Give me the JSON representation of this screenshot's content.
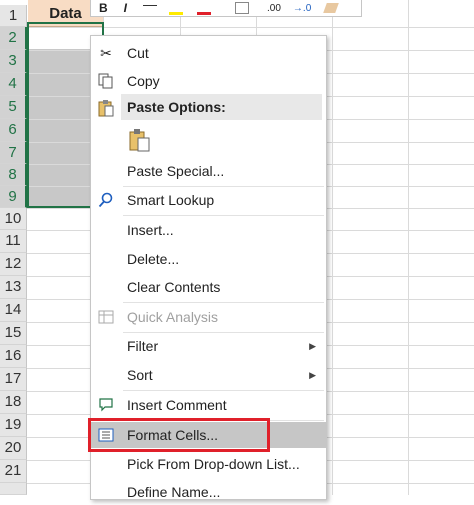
{
  "sheet": {
    "column_a_header": "Data",
    "row_numbers": [
      "1",
      "2",
      "3",
      "4",
      "5",
      "6",
      "7",
      "8",
      "9",
      "10",
      "11",
      "12",
      "13",
      "14",
      "15",
      "16",
      "17",
      "18",
      "19",
      "20",
      "21"
    ]
  },
  "mini_toolbar": {
    "bold": "B",
    "italic": "I",
    "decimal_increase": ".00",
    "decimal_decrease": "→.0"
  },
  "context_menu": {
    "cut": "Cut",
    "copy": "Copy",
    "paste_options": "Paste Options:",
    "paste_special": "Paste Special...",
    "smart_lookup": "Smart Lookup",
    "insert": "Insert...",
    "delete": "Delete...",
    "clear_contents": "Clear Contents",
    "quick_analysis": "Quick Analysis",
    "filter": "Filter",
    "sort": "Sort",
    "insert_comment": "Insert Comment",
    "format_cells": "Format Cells...",
    "pick_from_dropdown": "Pick From Drop-down List...",
    "define_name": "Define Name..."
  },
  "colors": {
    "selection": "#217346",
    "highlight_box": "#e0202a",
    "header_fill": "#f8dcc4"
  }
}
